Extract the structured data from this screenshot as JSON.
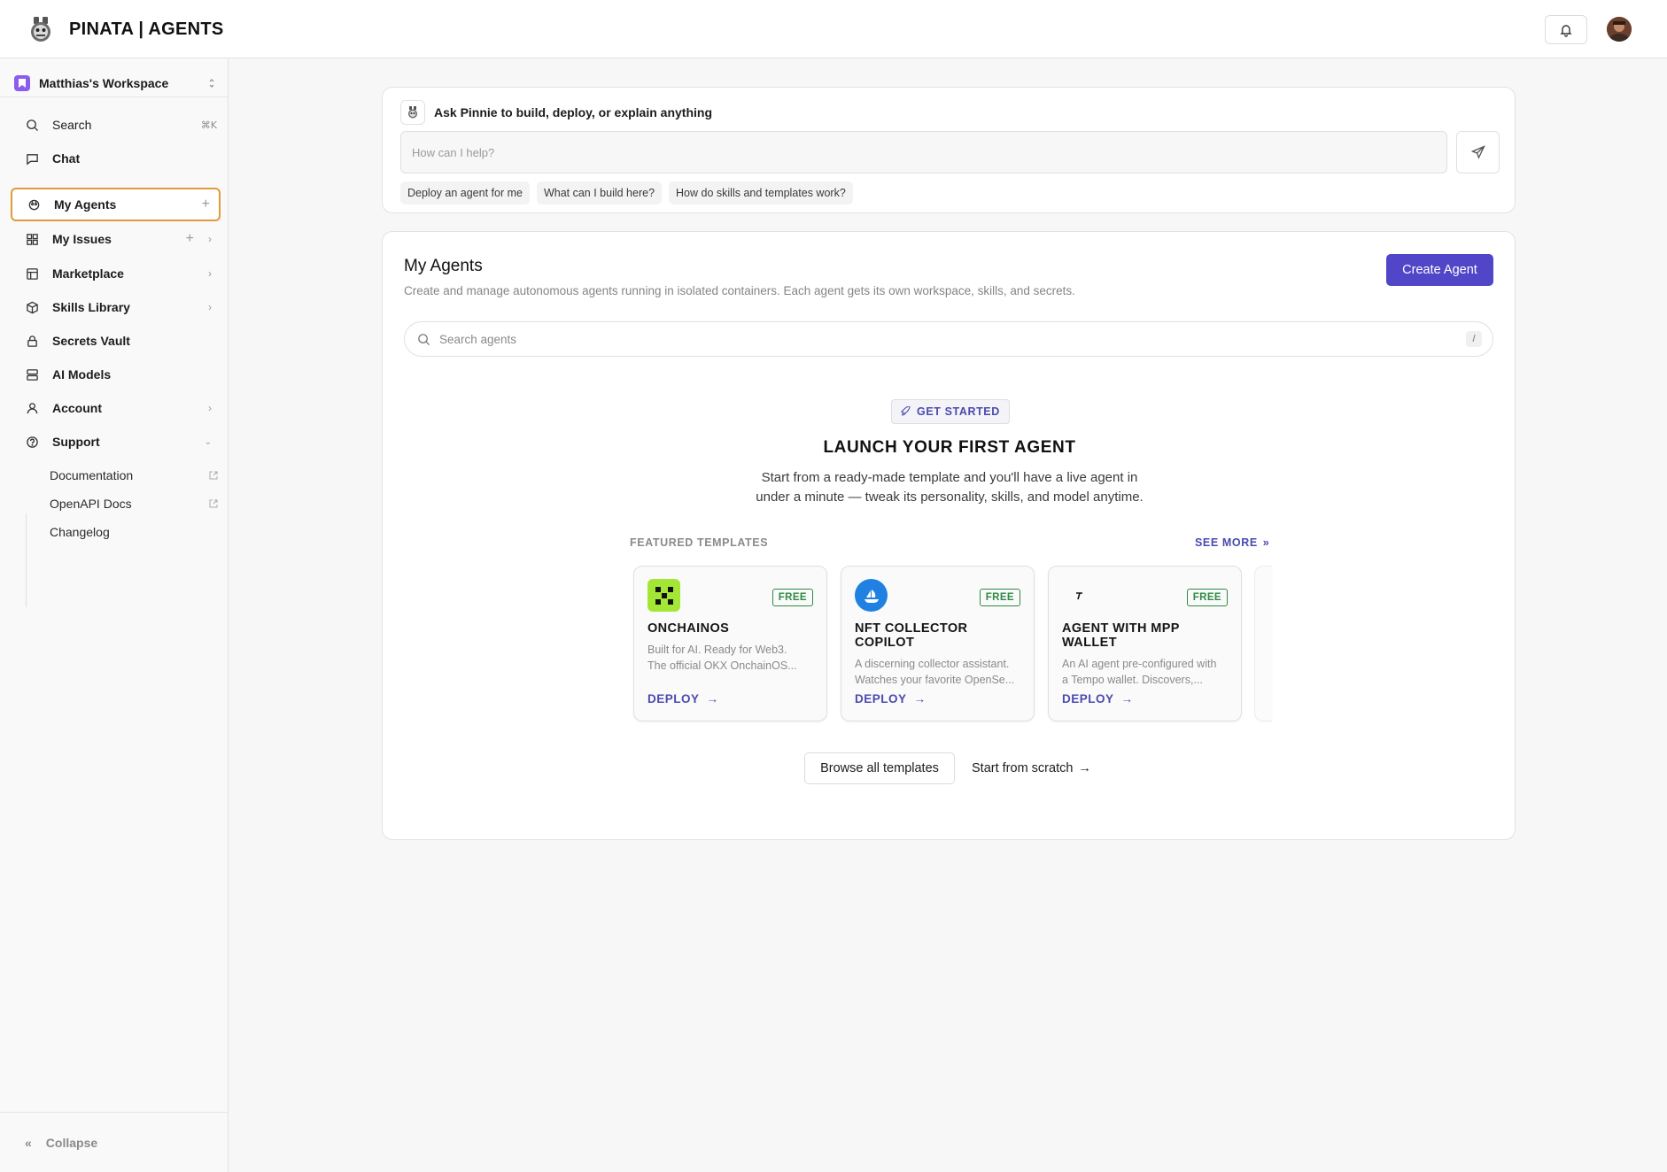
{
  "header": {
    "brand": "PINATA | AGENTS"
  },
  "sidebar": {
    "workspace": "Matthias's Workspace",
    "items": [
      {
        "label": "Search",
        "shortcut": "⌘K",
        "icon": "search-icon"
      },
      {
        "label": "Chat",
        "icon": "chat-icon"
      },
      {
        "label": "My Agents",
        "icon": "agent-icon",
        "active": true
      },
      {
        "label": "My Issues",
        "icon": "grid-icon"
      },
      {
        "label": "Marketplace",
        "icon": "marketplace-icon"
      },
      {
        "label": "Skills Library",
        "icon": "box-icon"
      },
      {
        "label": "Secrets Vault",
        "icon": "lock-icon"
      },
      {
        "label": "AI Models",
        "icon": "server-icon"
      },
      {
        "label": "Account",
        "icon": "user-icon"
      },
      {
        "label": "Support",
        "icon": "help-icon"
      }
    ],
    "support_links": [
      {
        "label": "Documentation",
        "external": true
      },
      {
        "label": "OpenAPI Docs",
        "external": true
      },
      {
        "label": "Changelog",
        "external": false
      }
    ],
    "collapse_label": "Collapse"
  },
  "ask": {
    "title": "Ask Pinnie to build, deploy, or explain anything",
    "placeholder": "How can I help?",
    "chips": [
      "Deploy an agent for me",
      "What can I build here?",
      "How do skills and templates work?"
    ]
  },
  "agents": {
    "title": "My Agents",
    "description": "Create and manage autonomous agents running in isolated containers. Each agent gets its own workspace, skills, and secrets.",
    "create_label": "Create Agent",
    "search_placeholder": "Search agents",
    "search_shortcut": "/",
    "badge": "GET STARTED",
    "launch_title": "LAUNCH YOUR FIRST AGENT",
    "launch_desc_1": "Start from a ready-made template and you'll have a live agent in",
    "launch_desc_2": "under a minute — tweak its personality, skills, and model anytime.",
    "featured_label": "FEATURED TEMPLATES",
    "see_more": "SEE MORE",
    "templates": [
      {
        "name": "ONCHAINOS",
        "price": "FREE",
        "desc_1": "Built for AI. Ready for Web3.",
        "desc_2": "The official OKX OnchainOS...",
        "cta": "DEPLOY",
        "logo_color": "#a3e635"
      },
      {
        "name": "NFT COLLECTOR COPILOT",
        "price": "FREE",
        "desc_1": "A discerning collector assistant.",
        "desc_2": "Watches your favorite OpenSe...",
        "cta": "DEPLOY",
        "logo_color": "#2081e2"
      },
      {
        "name": "AGENT WITH MPP WALLET",
        "price": "FREE",
        "desc_1": "An AI agent pre-configured with",
        "desc_2": "a Tempo wallet. Discovers,...",
        "cta": "DEPLOY",
        "logo_color": "#ffffff"
      }
    ],
    "browse_label": "Browse all templates",
    "scratch_label": "Start from scratch"
  },
  "colors": {
    "accent": "#5146c8",
    "active_border": "#e29a3a",
    "free_green": "#2f8a45"
  }
}
